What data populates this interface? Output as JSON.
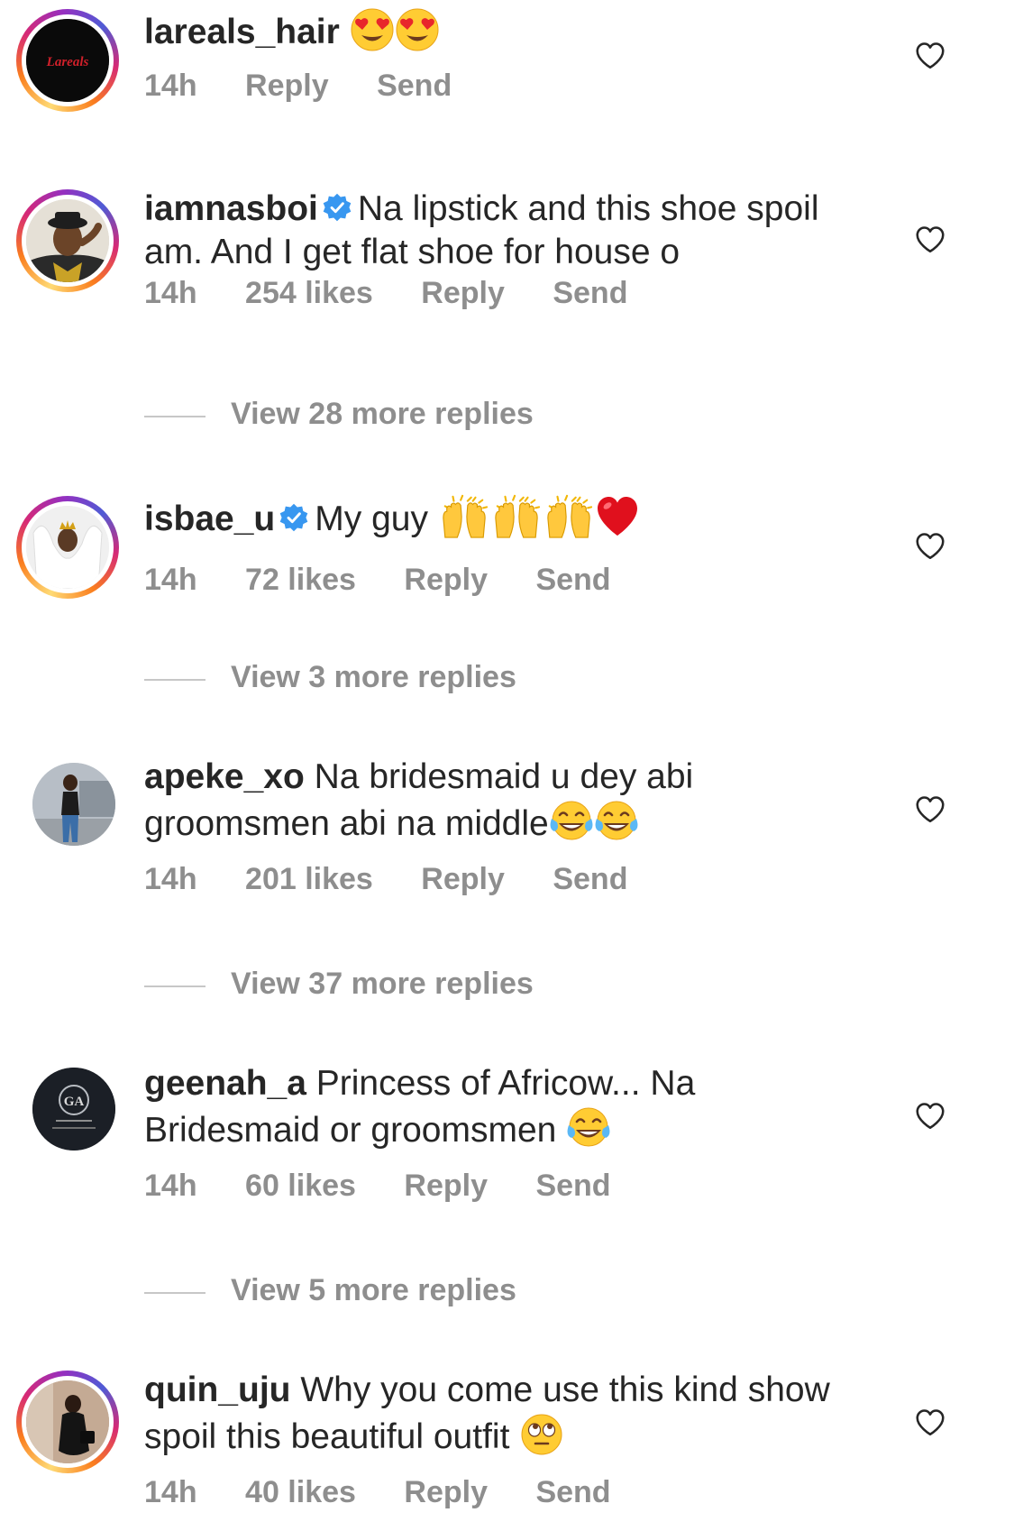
{
  "comments": [
    {
      "username": "lareals_hair",
      "text": "",
      "time": "14h",
      "likes": "",
      "reply": "Reply",
      "send": "Send",
      "avatar_logo": "Lareals"
    },
    {
      "username": "iamnasboi",
      "text": "Na lipstick and this shoe spoil am. And I get flat shoe for house o",
      "time": "14h",
      "likes": "254 likes",
      "reply": "Reply",
      "send": "Send",
      "view_more": "View 28 more replies"
    },
    {
      "username": "isbae_u",
      "text": "My guy",
      "time": "14h",
      "likes": "72 likes",
      "reply": "Reply",
      "send": "Send",
      "view_more": "View 3 more replies"
    },
    {
      "username": "apeke_xo",
      "text": "Na bridesmaid u dey abi groomsmen abi na middle",
      "time": "14h",
      "likes": "201 likes",
      "reply": "Reply",
      "send": "Send",
      "view_more": "View 37 more replies"
    },
    {
      "username": "geenah_a",
      "text": "Princess of Africow... Na Bridesmaid or groomsmen",
      "time": "14h",
      "likes": "60 likes",
      "reply": "Reply",
      "send": "Send",
      "view_more": "View 5 more replies",
      "avatar_logo": "GA"
    },
    {
      "username": "quin_uju",
      "text": "Why you come use this kind show spoil this beautiful outfit",
      "time": "14h",
      "likes": "40 likes",
      "reply": "Reply",
      "send": "Send"
    }
  ],
  "colors": {
    "text": "#262626",
    "meta": "#8e8e8e",
    "verified": "#3897f0",
    "divider": "#c7c7c7"
  }
}
